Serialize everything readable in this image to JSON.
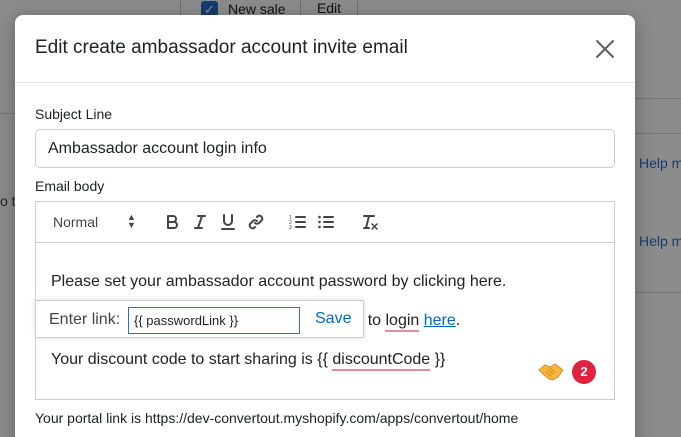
{
  "background": {
    "new_sale_label": "New sale",
    "edit_label": "Edit",
    "left_fragment": "o t",
    "help_links": [
      "Help me s",
      "Help m"
    ]
  },
  "modal": {
    "title": "Edit create ambassador account invite email",
    "subject": {
      "label": "Subject Line",
      "value": "Ambassador account login info"
    },
    "email_body": {
      "label": "Email body",
      "toolbar": {
        "format_value": "Normal",
        "buttons": [
          "bold-icon",
          "italic-icon",
          "underline-icon",
          "link-icon",
          "ordered-list-icon",
          "bullet-list-icon",
          "clear-format-icon"
        ]
      },
      "line1": "Please set your ambassador account password by clicking here.",
      "line2_prefix": "able to ",
      "line2_login": "login",
      "line2_space": " ",
      "line2_link": "here",
      "line2_suffix": ".",
      "line3_prefix": "Your discount code to start sharing is {{ ",
      "line3_code": "discountCode",
      "line3_suffix": " }}",
      "link_tooltip": {
        "label": "Enter link:",
        "value": "{{ passwordLink }}",
        "save_label": "Save"
      },
      "grammar_badge_count": "2"
    },
    "portal_text": "Your portal link is https://dev-convertout.myshopify.com/apps/convertout/home"
  },
  "colors": {
    "accent": "#2c6ecb",
    "link": "#0066cc",
    "badge": "#e0213f",
    "squiggle": "#e68aa6"
  }
}
